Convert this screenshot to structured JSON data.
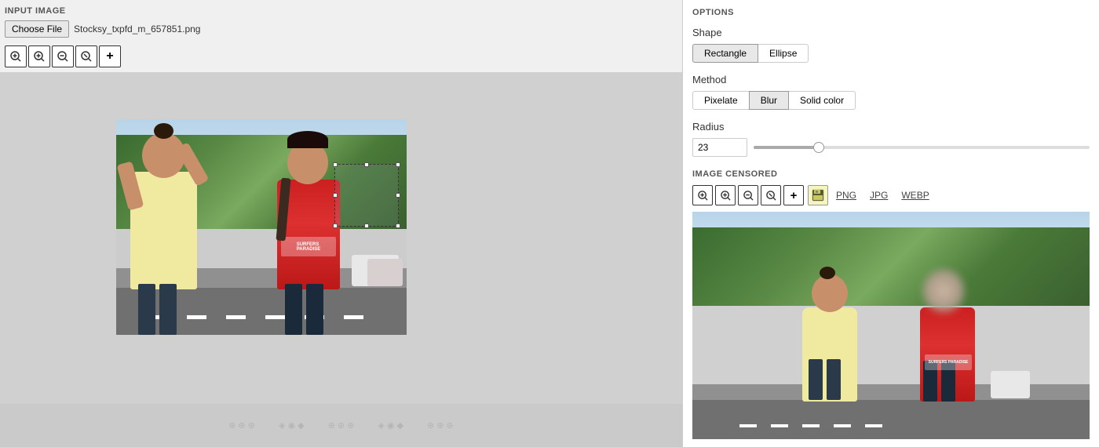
{
  "left": {
    "input_label": "INPUT IMAGE",
    "choose_file_label": "Choose File",
    "filename": "Stocksy_txpfd_m_657851.png",
    "zoom_buttons": [
      {
        "id": "zoom-in",
        "icon": "⊕",
        "title": "Zoom In"
      },
      {
        "id": "zoom-in-2",
        "icon": "⊕",
        "title": "Zoom In 2"
      },
      {
        "id": "zoom-out",
        "icon": "⊖",
        "title": "Zoom Out"
      },
      {
        "id": "zoom-fit",
        "icon": "⊗",
        "title": "Fit"
      },
      {
        "id": "zoom-add",
        "icon": "+",
        "title": "Add"
      }
    ]
  },
  "right": {
    "options_title": "OPTIONS",
    "shape_label": "Shape",
    "shape_buttons": [
      {
        "label": "Rectangle",
        "active": true
      },
      {
        "label": "Ellipse",
        "active": false
      }
    ],
    "method_label": "Method",
    "method_buttons": [
      {
        "label": "Pixelate",
        "active": false
      },
      {
        "label": "Blur",
        "active": true
      },
      {
        "label": "Solid color",
        "active": false
      }
    ],
    "radius_label": "Radius",
    "radius_value": "23",
    "radius_min": 0,
    "radius_max": 100,
    "radius_percent": 23,
    "image_censored_title": "IMAGE CENSORED",
    "censored_zoom_buttons": [
      {
        "icon": "⊕",
        "title": "Zoom In"
      },
      {
        "icon": "⊕",
        "title": "Zoom In 2"
      },
      {
        "icon": "⊖",
        "title": "Zoom Out"
      },
      {
        "icon": "⊗",
        "title": "Fit"
      },
      {
        "icon": "+",
        "title": "Add"
      }
    ],
    "save_icon": "💾",
    "format_buttons": [
      "PNG",
      "JPG",
      "WEBP"
    ]
  }
}
